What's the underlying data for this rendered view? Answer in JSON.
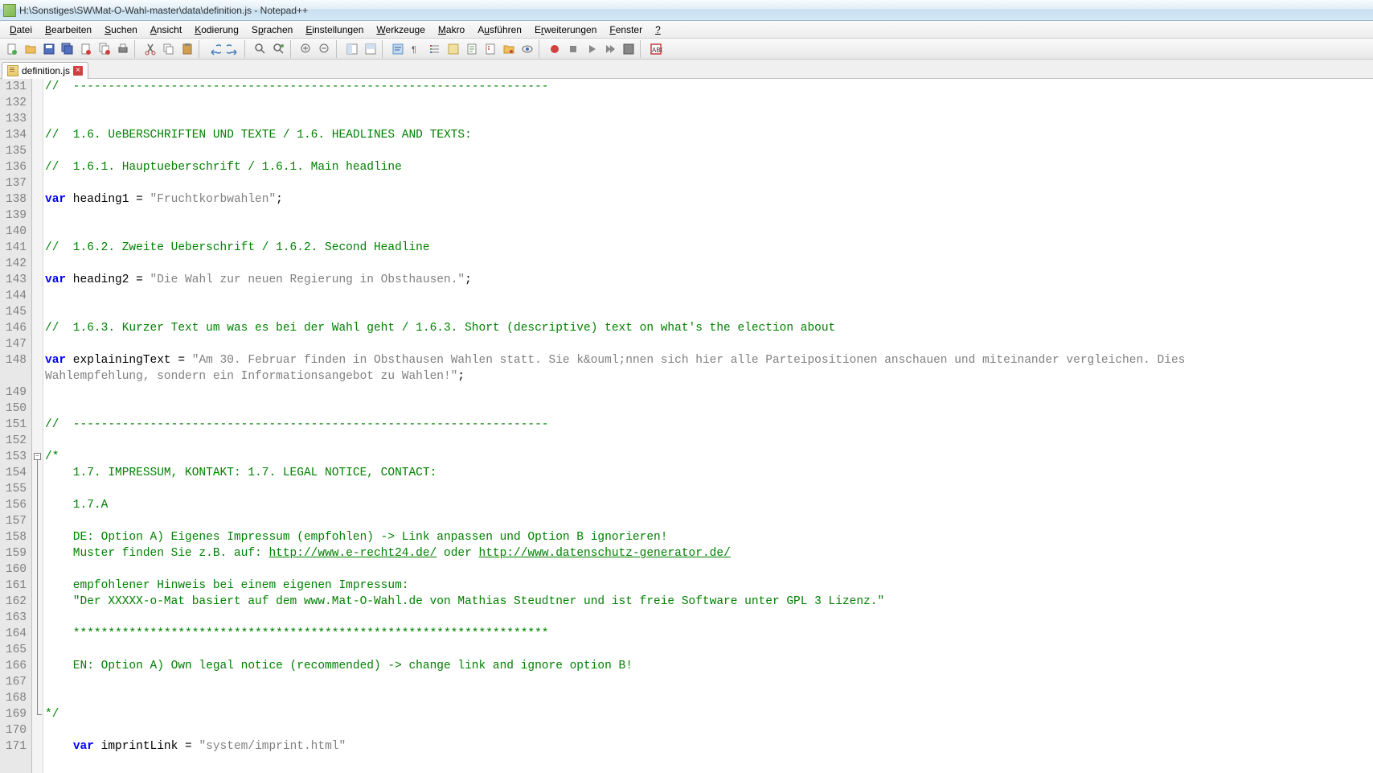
{
  "title": "H:\\Sonstiges\\SW\\Mat-O-Wahl-master\\data\\definition.js - Notepad++",
  "menu": {
    "datei": "Datei",
    "bearbeiten": "Bearbeiten",
    "suchen": "Suchen",
    "ansicht": "Ansicht",
    "kodierung": "Kodierung",
    "sprachen": "Sprachen",
    "einstellungen": "Einstellungen",
    "werkzeuge": "Werkzeuge",
    "makro": "Makro",
    "ausfuehren": "Ausführen",
    "erweiterungen": "Erweiterungen",
    "fenster": "Fenster",
    "help": "?"
  },
  "tab": {
    "name": "definition.js",
    "close": "×"
  },
  "lines": {
    "start": 131,
    "end": 171
  },
  "code": {
    "l131": "//  --------------------------------------------------------------------",
    "l134": "//  1.6. UeBERSCHRIFTEN UND TEXTE / 1.6. HEADLINES AND TEXTS:",
    "l136": "//  1.6.1. Hauptueberschrift / 1.6.1. Main headline",
    "l138_kw": "var",
    "l138_id": " heading1 = ",
    "l138_str": "\"Fruchtkorbwahlen\"",
    "l138_end": ";",
    "l141": "//  1.6.2. Zweite Ueberschrift / 1.6.2. Second Headline",
    "l143_kw": "var",
    "l143_id": " heading2 = ",
    "l143_str": "\"Die Wahl zur neuen Regierung in Obsthausen.\"",
    "l143_end": ";",
    "l146": "//  1.6.3. Kurzer Text um was es bei der Wahl geht / 1.6.3. Short (descriptive) text on what's the election about",
    "l148_kw": "var",
    "l148_id": " explainingText = ",
    "l148_str": "\"Am 30. Februar finden in Obsthausen Wahlen statt. Sie k&ouml;nnen sich hier alle Parteipositionen anschauen und miteinander vergleichen. Dies",
    "l148b_str": "Wahlempfehlung, sondern ein Informationsangebot zu Wahlen!\"",
    "l148b_end": ";",
    "l151": "//  --------------------------------------------------------------------",
    "l153": "/*",
    "l154": "    1.7. IMPRESSUM, KONTAKT: 1.7. LEGAL NOTICE, CONTACT:",
    "l156": "    1.7.A",
    "l158": "    DE: Option A) Eigenes Impressum (empfohlen) -> Link anpassen und Option B ignorieren!",
    "l159a": "    Muster finden Sie z.B. auf: ",
    "l159_link1": "http://www.e-recht24.de/",
    "l159b": " oder ",
    "l159_link2": "http://www.datenschutz-generator.de/",
    "l161": "    empfohlener Hinweis bei einem eigenen Impressum:",
    "l162": "    \"Der XXXXX-o-Mat basiert auf dem www.Mat-O-Wahl.de von Mathias Steudtner und ist freie Software unter GPL 3 Lizenz.\"",
    "l164": "    ********************************************************************",
    "l166": "    EN: Option A) Own legal notice (recommended) -> change link and ignore option B!",
    "l169": "*/",
    "l171_kw": "var",
    "l171_id": " imprintLink = ",
    "l171_str": "\"system/imprint.html\""
  }
}
